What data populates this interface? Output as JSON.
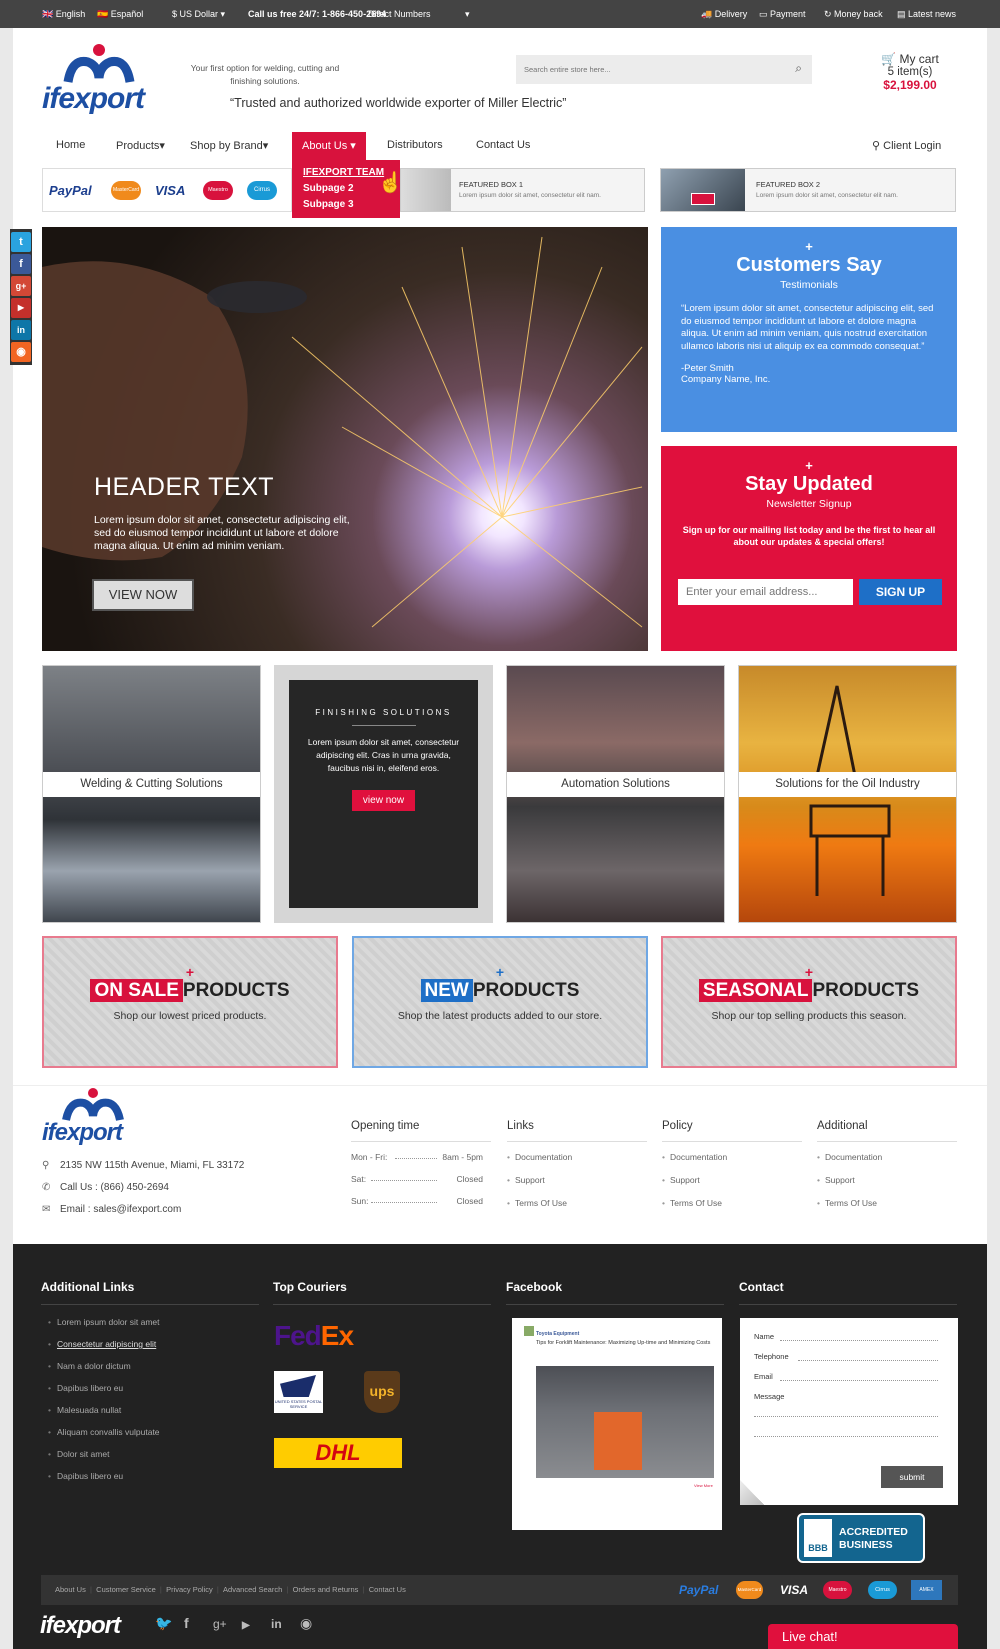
{
  "topbar": {
    "lang_en": "English",
    "lang_es": "Español",
    "currency": "$ US Dollar",
    "call_label": "Call us free 24/7: 1-866-450-2694",
    "direct": "Direct Numbers",
    "delivery": "Delivery",
    "payment": "Payment",
    "money_back": "Money back",
    "latest_news": "Latest news"
  },
  "header": {
    "logo": "ifexport",
    "tagline": "Your first option for welding, cutting and finishing solutions.",
    "trusted": "“Trusted and authorized worldwide exporter of Miller Electric”",
    "search_placeholder": "Search entire store here...",
    "cart_title": "My cart",
    "cart_count": "5 item(s)",
    "cart_total": "$2,199.00"
  },
  "nav": {
    "home": "Home",
    "products": "Products",
    "shop_by_brand": "Shop by Brand",
    "about_us": "About Us",
    "distributors": "Distributors",
    "contact_us": "Contact Us",
    "client_login": "Client Login"
  },
  "dropdown": [
    "IFEXPORT TEAM",
    "Subpage 2",
    "Subpage 3"
  ],
  "payments": [
    "PayPal",
    "MasterCard",
    "VISA",
    "Maestro",
    "Cirrus"
  ],
  "featured": [
    {
      "title": "FEATURED BOX 1",
      "text": "Lorem ipsum dolor sit amet, consectetur elit nam."
    },
    {
      "title": "FEATURED BOX 2",
      "text": "Lorem ipsum dolor sit amet, consectetur elit nam."
    }
  ],
  "hero": {
    "header": "HEADER TEXT",
    "text": "Lorem ipsum dolor sit amet, consectetur adipiscing elit, sed do eiusmod tempor incididunt ut labore et dolore magna aliqua. Ut enim ad minim veniam.",
    "button": "VIEW NOW"
  },
  "testimonial": {
    "plus": "+",
    "title": "Customers Say",
    "subtitle": "Testimonials",
    "quote": "“Lorem ipsum dolor sit amet, consectetur adipiscing elit, sed do eiusmod tempor incididunt ut labore et dolore magna aliqua. Ut enim ad minim veniam, quis nostrud exercitation ullamco laboris nisi ut aliquip ex ea commodo consequat.”",
    "author": "-Peter Smith",
    "company": "Company Name, Inc."
  },
  "newsletter": {
    "plus": "+",
    "title": "Stay Updated",
    "subtitle": "Newsletter Signup",
    "text": "Sign up for our mailing list today and be the first to hear all about our updates & special offers!",
    "placeholder": "Enter your email address...",
    "button": "SIGN UP"
  },
  "categories": {
    "welding": "Welding & Cutting Solutions",
    "finishing_title": "FINISHING SOLUTIONS",
    "finishing_text": "Lorem ipsum dolor sit amet, consectetur adipiscing elit. Cras in urna gravida, faucibus nisi in, eleifend eros.",
    "finishing_button": "view now",
    "automation": "Automation Solutions",
    "oil": "Solutions for the Oil Industry"
  },
  "products": [
    {
      "highlight": "ON SALE",
      "rest": "PRODUCTS",
      "text": "Shop our lowest priced products.",
      "color": "#d8123d"
    },
    {
      "highlight": "NEW",
      "rest": "PRODUCTS",
      "text": "Shop the latest products added to our store.",
      "color": "#1e6fc7"
    },
    {
      "highlight": "SEASONAL",
      "rest": "PRODUCTS",
      "text": "Shop our top selling products this season.",
      "color": "#d8123d"
    }
  ],
  "footer_info": {
    "logo": "ifexport",
    "address": "2135 NW 115th Avenue, Miami, FL 33172",
    "phone": "Call Us : (866) 450-2694",
    "email": "Email : sales@ifexport.com",
    "opening_title": "Opening time",
    "opening": [
      {
        "day": "Mon - Fri:",
        "time": "8am - 5pm"
      },
      {
        "day": "Sat:",
        "time": "Closed"
      },
      {
        "day": "Sun:",
        "time": "Closed"
      }
    ],
    "links_title": "Links",
    "policy_title": "Policy",
    "additional_title": "Additional",
    "col_items": [
      "Documentation",
      "Support",
      "Terms Of Use"
    ]
  },
  "dark_footer": {
    "additional_links_title": "Additional Links",
    "additional_links": [
      "Lorem ipsum dolor sit amet",
      "Consectetur adipiscing elit",
      "Nam a dolor dictum",
      "Dapibus libero eu",
      "Malesuada nullat",
      "Aliquam convallis vulputate",
      "Dolor sit amet",
      "Dapibus libero eu"
    ],
    "couriers_title": "Top Couriers",
    "couriers": {
      "fedex_fed": "Fed",
      "fedex_ex": "Ex",
      "usps": "UNITED STATES POSTAL SERVICE",
      "ups": "ups",
      "dhl": "DHL"
    },
    "facebook_title": "Facebook",
    "fb_user": "Toyota Equipment",
    "fb_text": "Tips for Forklift Maintenance: Maximizing Up-time and Minimizing Costs",
    "fb_link": "View More",
    "contact_title": "Contact",
    "contact_fields": [
      "Name",
      "Telephone",
      "Email",
      "Message"
    ],
    "submit": "submit",
    "bbb_line1": "ACCREDITED",
    "bbb_line2": "BUSINESS",
    "bbb_logo": "BBB"
  },
  "bottom_bar": {
    "links": [
      "About Us",
      "Customer Service",
      "Privacy Policy",
      "Advanced Search",
      "Orders and Returns",
      "Contact Us"
    ],
    "cards": [
      "PayPal",
      "MasterCard",
      "VISA",
      "Maestro",
      "Cirrus",
      "AMEX"
    ]
  },
  "very_bottom": {
    "logo": "ifexport",
    "live_chat": "Live chat!"
  },
  "colors": {
    "red": "#d8123d",
    "blue": "#4a8fe2",
    "dark": "#222222"
  }
}
